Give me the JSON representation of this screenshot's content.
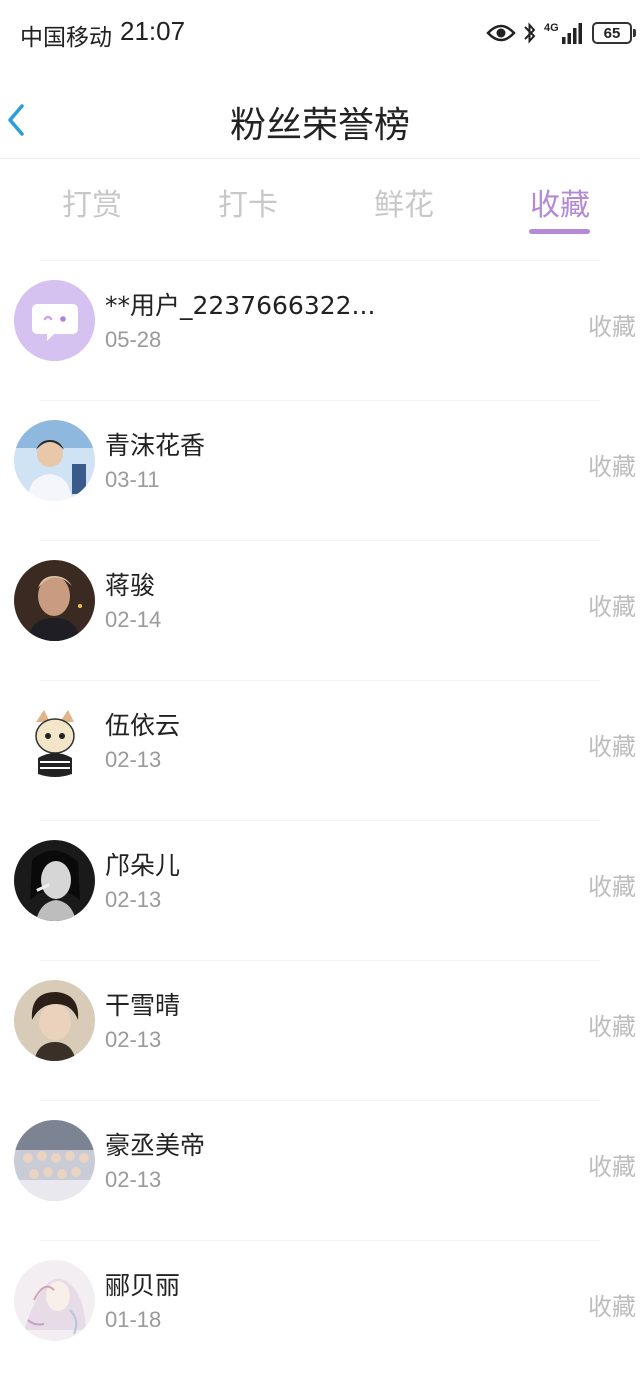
{
  "status_bar": {
    "carrier": "中国移动",
    "time": "21:07",
    "network": "4G",
    "battery": "65"
  },
  "header": {
    "title": "粉丝荣誉榜"
  },
  "tabs": [
    {
      "label": "打赏",
      "active": false
    },
    {
      "label": "打卡",
      "active": false
    },
    {
      "label": "鲜花",
      "active": false
    },
    {
      "label": "收藏",
      "active": true
    }
  ],
  "accent_color": "#b38ad8",
  "fans": [
    {
      "name": "**用户_2237666322...",
      "date": "05-28",
      "action": "收藏"
    },
    {
      "name": "青沫花香",
      "date": "03-11",
      "action": "收藏"
    },
    {
      "name": "蒋骏",
      "date": "02-14",
      "action": "收藏"
    },
    {
      "name": "伍依云",
      "date": "02-13",
      "action": "收藏"
    },
    {
      "name": "邝朵儿",
      "date": "02-13",
      "action": "收藏"
    },
    {
      "name": "干雪晴",
      "date": "02-13",
      "action": "收藏"
    },
    {
      "name": "豪丞美帝",
      "date": "02-13",
      "action": "收藏"
    },
    {
      "name": "郦贝丽",
      "date": "01-18",
      "action": "收藏"
    }
  ]
}
